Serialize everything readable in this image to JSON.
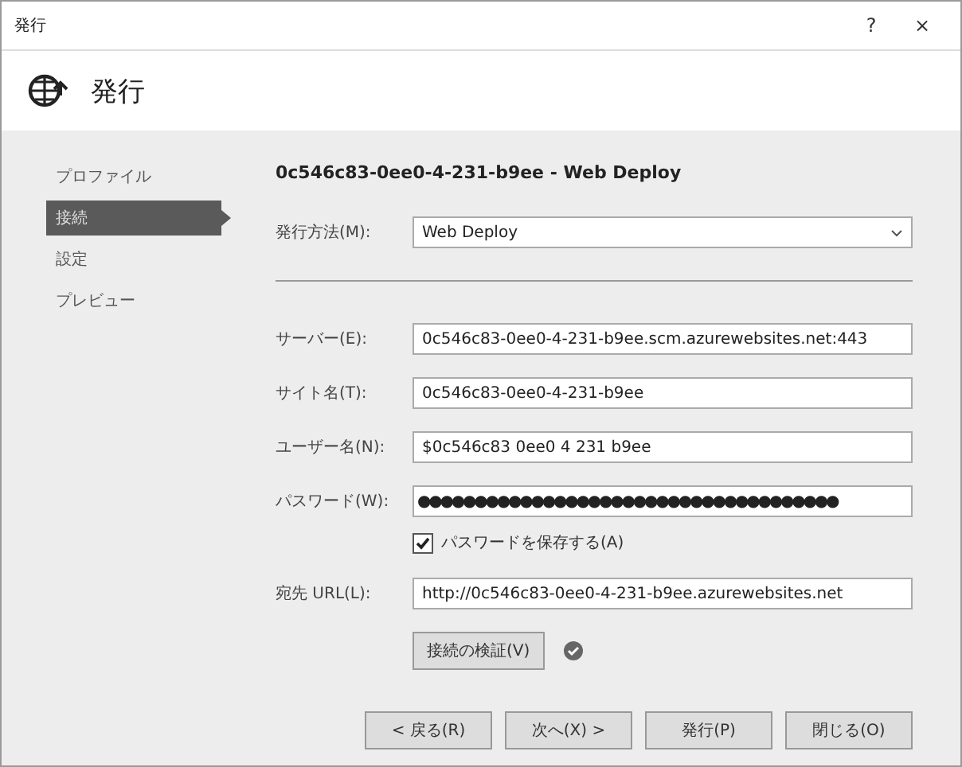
{
  "window": {
    "title": "発行",
    "help": "?",
    "close": "×"
  },
  "header": {
    "title": "発行"
  },
  "sidebar": {
    "items": [
      {
        "label": "プロファイル",
        "selected": false
      },
      {
        "label": "接続",
        "selected": true
      },
      {
        "label": "設定",
        "selected": false
      },
      {
        "label": "プレビュー",
        "selected": false
      }
    ]
  },
  "profile_title": "0c546c83-0ee0-4-231-b9ee - Web Deploy",
  "publish_method": {
    "label": "発行方法(M):",
    "value": "Web Deploy"
  },
  "fields": [
    {
      "label": "サーバー(E):",
      "value": "0c546c83-0ee0-4-231-b9ee.scm.azurewebsites.net:443"
    },
    {
      "label": "サイト名(T):",
      "value": "0c546c83-0ee0-4-231-b9ee"
    },
    {
      "label": "ユーザー名(N):",
      "value": "$0c546c83 0ee0 4 231 b9ee"
    },
    {
      "label": "パスワード(W):",
      "value": "●●●●●●●●●●●●●●●●●●●●●●●●●●●●●●●●●●●●●"
    }
  ],
  "save_password": {
    "label": "パスワードを保存する(A)",
    "checked": true
  },
  "destination_url": {
    "label": "宛先 URL(L):",
    "value": "http://0c546c83-0ee0-4-231-b9ee.azurewebsites.net"
  },
  "validate": {
    "label": "接続の検証(V)",
    "verified": true
  },
  "buttons": [
    "< 戻る(R)",
    "次へ(X) >",
    "発行(P)",
    "閉じる(O)"
  ]
}
